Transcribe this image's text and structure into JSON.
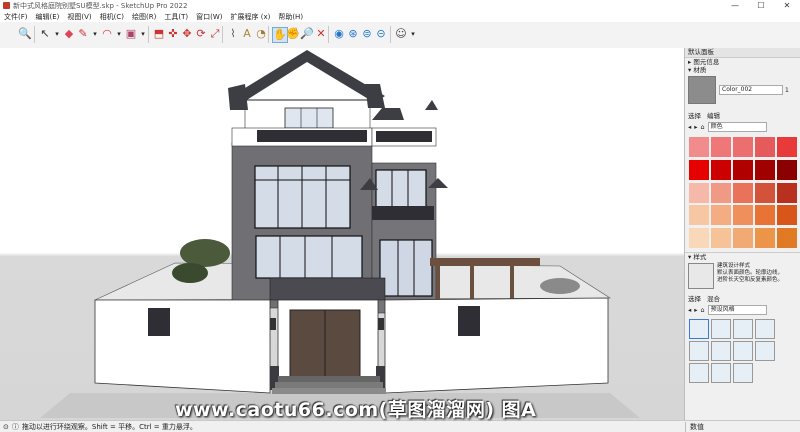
{
  "window": {
    "title": "新中式风格庭院别墅SU模型.skp - SketchUp Pro 2022"
  },
  "menu": [
    "文件(F)",
    "编辑(E)",
    "视图(V)",
    "相机(C)",
    "绘图(R)",
    "工具(T)",
    "窗口(W)",
    "扩展程序 (x)",
    "帮助(H)"
  ],
  "toolbar": {
    "tools": [
      "zoom-icon",
      "select-icon",
      "eraser-icon",
      "line-icon",
      "arc-icon",
      "paint-icon",
      "push-pull-icon",
      "move-icon",
      "rotate-icon",
      "scale-icon",
      "follow-icon",
      "tape-icon",
      "protractor-icon",
      "text-icon",
      "orbit-icon",
      "pan-icon",
      "zoom-tool-icon",
      "zoom-extents-icon",
      "prev-view-icon",
      "walk-icon",
      "look-icon",
      "position-camera-icon",
      "user-icon"
    ]
  },
  "tray": {
    "title": "默认面板",
    "entity_info": "图元信息",
    "materials": "材质",
    "material_name": "Color_002",
    "material_count": "1",
    "tab_select": "选择",
    "tab_edit": "编辑",
    "color_category": "颜色",
    "swatches": [
      "#f28c8c",
      "#ef7777",
      "#ec6f6f",
      "#e55a5a",
      "#e83a3a",
      "#e60000",
      "#cc0000",
      "#b00000",
      "#a00000",
      "#8a0000",
      "#f6b8a8",
      "#f09a86",
      "#e8725a",
      "#d2523a",
      "#b8301e",
      "#f7c7a4",
      "#f4ad83",
      "#ef8f5c",
      "#e87334",
      "#d9561a",
      "#f8d8b8",
      "#f6c298",
      "#f2aa74",
      "#ec9448",
      "#e07a24"
    ],
    "styles": "样式",
    "style_name": "建筑设计样式",
    "style_desc": "默认表面颜色。轮廓边线，\n进阶长天空和反复素颜色。",
    "style_tab_select": "选择",
    "style_tab_mix": "混合",
    "style_category": "预设风格"
  },
  "status": {
    "hint": "拖动以进行环绕观察。Shift = 平移。Ctrl = 重力悬浮。",
    "measure_label": "数值"
  },
  "watermark": "www.caotu66.com(草图溜溜网) 图A"
}
